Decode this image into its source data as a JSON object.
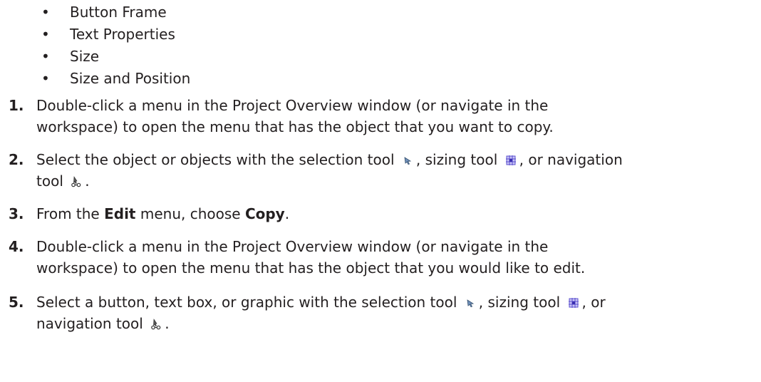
{
  "bullets": [
    "Button Frame",
    "Text Properties",
    "Size",
    "Size and Position"
  ],
  "steps": [
    {
      "number": "1.",
      "line1": "Double-click a menu in the Project Overview window (or navigate in the",
      "line2": "workspace) to open the menu that has the object that you want to copy."
    },
    {
      "number": "2.",
      "part1": "Select the object or objects with the selection tool",
      "part2": ", sizing tool",
      "part3": ", or navigation",
      "part4": "tool",
      "part5": "."
    },
    {
      "number": "3.",
      "part1": "From the ",
      "bold1": "Edit",
      "part2": " menu, choose ",
      "bold2": "Copy",
      "part3": "."
    },
    {
      "number": "4.",
      "line1": "Double-click a menu in the Project Overview window (or navigate in the",
      "line2": "workspace) to open the menu that has the object that you would like to edit."
    },
    {
      "number": "5.",
      "part1": "Select a button, text box, or graphic with the selection tool",
      "part2": ", sizing tool",
      "part3": ", or",
      "part4": "navigation tool",
      "part5": "."
    }
  ],
  "icons": {
    "selection_tool": "selection-tool-icon",
    "sizing_tool": "sizing-tool-icon",
    "navigation_tool": "navigation-tool-icon"
  },
  "colors": {
    "text": "#231f20",
    "sizing_icon": "#5a4fcf",
    "selection_icon": "#4a6fa5"
  }
}
